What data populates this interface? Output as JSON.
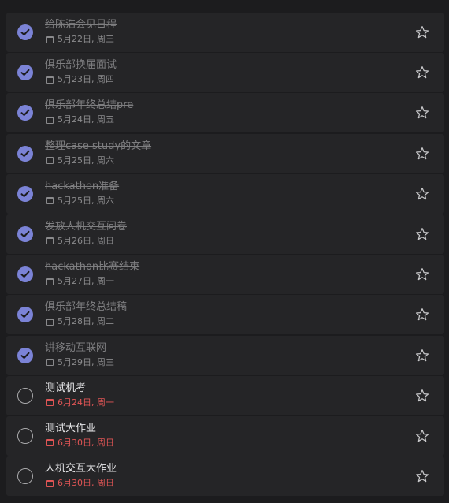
{
  "tasks": [
    {
      "title": "给陈浩会见日程",
      "date": "5月22日, 周三",
      "completed": true
    },
    {
      "title": "俱乐部换届面试",
      "date": "5月23日, 周四",
      "completed": true
    },
    {
      "title": "俱乐部年终总结pre",
      "date": "5月24日, 周五",
      "completed": true
    },
    {
      "title": "整理case study的文章",
      "date": "5月25日, 周六",
      "completed": true
    },
    {
      "title": "hackathon准备",
      "date": "5月25日, 周六",
      "completed": true
    },
    {
      "title": "发放人机交互问卷",
      "date": "5月26日, 周日",
      "completed": true
    },
    {
      "title": "hackathon比赛结束",
      "date": "5月27日, 周一",
      "completed": true
    },
    {
      "title": "俱乐部年终总结稿",
      "date": "5月28日, 周二",
      "completed": true
    },
    {
      "title": "讲移动互联网",
      "date": "5月29日, 周三",
      "completed": true
    },
    {
      "title": "测试机考",
      "date": "6月24日, 周一",
      "completed": false
    },
    {
      "title": "测试大作业",
      "date": "6月30日, 周日",
      "completed": false
    },
    {
      "title": "人机交互大作业",
      "date": "6月30日, 周日",
      "completed": false
    }
  ],
  "colors": {
    "accent": "#7b83d6",
    "overdue": "#e05555",
    "row_bg": "#252527",
    "page_bg": "#1c1c1e"
  },
  "icons": {
    "check": "check-icon",
    "calendar": "calendar-icon",
    "star": "star-outline-icon"
  }
}
